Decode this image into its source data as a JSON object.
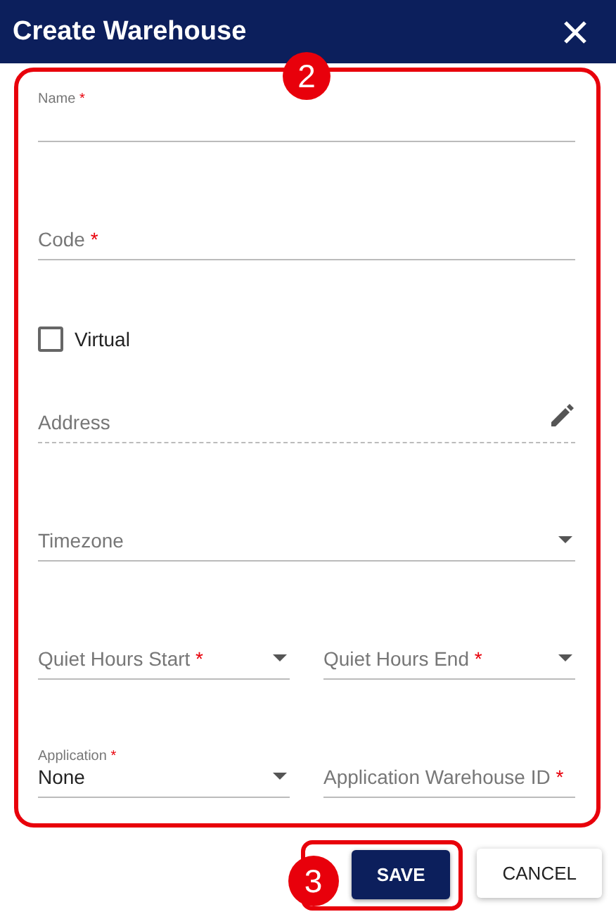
{
  "dialog": {
    "title": "Create Warehouse"
  },
  "form": {
    "badge": "2",
    "rows": [
      [
        {
          "kind": "text",
          "label": "Name",
          "required_mark": "*",
          "floated": true
        }
      ],
      [
        {
          "kind": "text",
          "label": "Code",
          "required_mark": "*",
          "floated": false
        }
      ],
      [
        {
          "kind": "checkbox",
          "label": "Virtual",
          "checked": false
        }
      ],
      [
        {
          "kind": "editable",
          "label": "Address",
          "floated": false
        }
      ],
      [
        {
          "kind": "select",
          "label": "Timezone",
          "floated": false
        }
      ],
      [
        {
          "kind": "select",
          "label": "Quiet Hours Start",
          "required_mark": "*",
          "floated": false
        },
        {
          "kind": "select",
          "label": "Quiet Hours End",
          "required_mark": "*",
          "floated": false
        }
      ],
      [
        {
          "kind": "select",
          "label": "Application",
          "required_mark": "*",
          "floated": true,
          "value": "None"
        },
        {
          "kind": "text",
          "label": "Application Warehouse ID",
          "required_mark": "*",
          "floated": false
        }
      ]
    ]
  },
  "actions": {
    "badge": "3",
    "buttons": [
      {
        "label": "SAVE",
        "kind": "primary",
        "highlighted": true
      },
      {
        "label": "CANCEL",
        "kind": "secondary",
        "highlighted": false
      }
    ]
  }
}
